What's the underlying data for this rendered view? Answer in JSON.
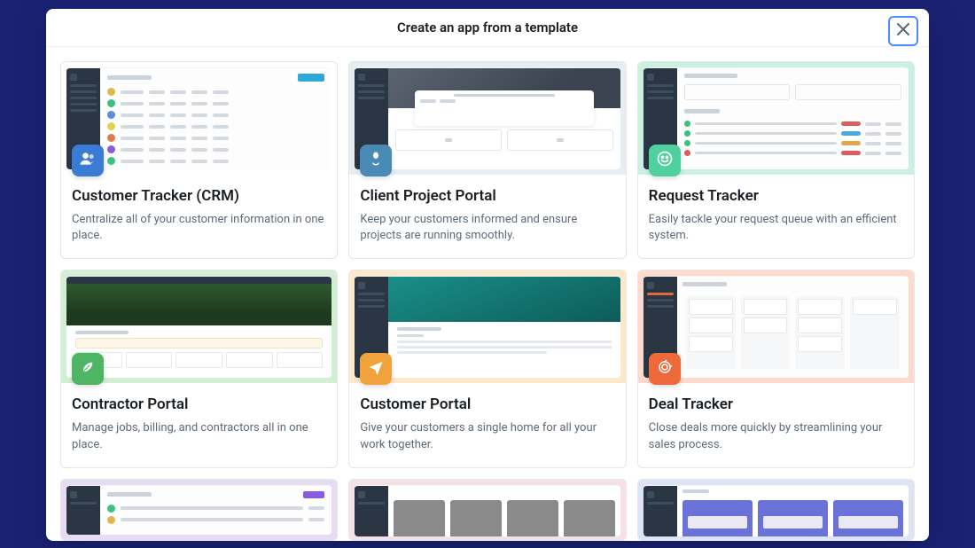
{
  "modal": {
    "title": "Create an app from a template"
  },
  "templates": [
    {
      "title": "Customer Tracker (CRM)",
      "description": "Centralize all of your customer information in one place.",
      "accent": "#cfe6f7",
      "badge_bg": "#3a7bd5",
      "icon": "users"
    },
    {
      "title": "Client Project Portal",
      "description": "Keep your customers informed and ensure projects are running smoothly.",
      "accent": "#e7eef2",
      "badge_bg": "#4a8bb5",
      "icon": "tulip"
    },
    {
      "title": "Request Tracker",
      "description": "Easily tackle your request queue with an efficient system.",
      "accent": "#caf1e0",
      "badge_bg": "#4ed19f",
      "icon": "smile"
    },
    {
      "title": "Contractor Portal",
      "description": "Manage jobs, billing, and contractors all in one place.",
      "accent": "#d3efd3",
      "badge_bg": "#4eb565",
      "icon": "leaf"
    },
    {
      "title": "Customer Portal",
      "description": "Give your customers a single home for all your work together.",
      "accent": "#fde8c9",
      "badge_bg": "#f0a33c",
      "icon": "plane"
    },
    {
      "title": "Deal Tracker",
      "description": "Close deals more quickly by streamlining your sales process.",
      "accent": "#fddacc",
      "badge_bg": "#ef6a3a",
      "icon": "target"
    },
    {
      "title": "",
      "description": "",
      "accent": "#e7dcf2",
      "badge_bg": "",
      "icon": ""
    },
    {
      "title": "",
      "description": "",
      "accent": "#f5e1e6",
      "badge_bg": "",
      "icon": ""
    },
    {
      "title": "",
      "description": "",
      "accent": "#dde4f5",
      "badge_bg": "",
      "icon": ""
    }
  ]
}
